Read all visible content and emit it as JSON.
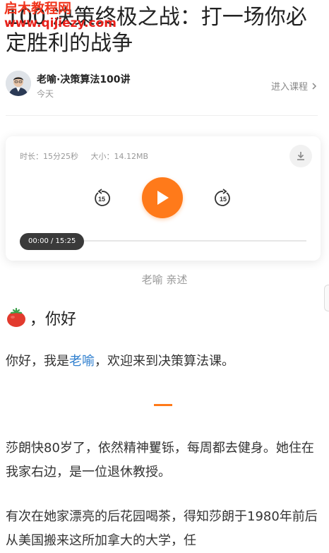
{
  "watermark": {
    "line1": "启木教程网",
    "line2": "www.qijiezy.com"
  },
  "article": {
    "title": "100 决策终极之战：打一场你必定胜利的战争"
  },
  "author": {
    "name": "老喻·决策算法100讲",
    "date": "今天",
    "enter_course_label": "进入课程"
  },
  "player": {
    "duration_label": "时长：15分25秒",
    "size_label": "大小：14.12MB",
    "time_display": "00:00 / 15:25",
    "skip_back_seconds": "15",
    "skip_forward_seconds": "15",
    "progress": 0,
    "accent_color": "#ff7a1a"
  },
  "narrator": "老喻 亲述",
  "content": {
    "greeting": "，你好",
    "intro_prefix": "你好，我是",
    "intro_link": "老喻",
    "intro_suffix": "，欢迎来到决策算法课。",
    "paragraph2": "莎朗快80岁了，依然精神矍铄，每周都去健身。她住在我家右边，是一位退休教授。",
    "paragraph3": "有次在她家漂亮的后花园喝茶，得知莎朗于1980年前后从美国搬来这所加拿大的大学，任"
  },
  "icons": {
    "avatar": "author-avatar",
    "greeting": "tomato-icon",
    "download": "download-icon",
    "play": "play-icon",
    "skip_back": "rewind-15-icon",
    "skip_forward": "forward-15-icon",
    "chevron": "chevron-right-icon"
  }
}
